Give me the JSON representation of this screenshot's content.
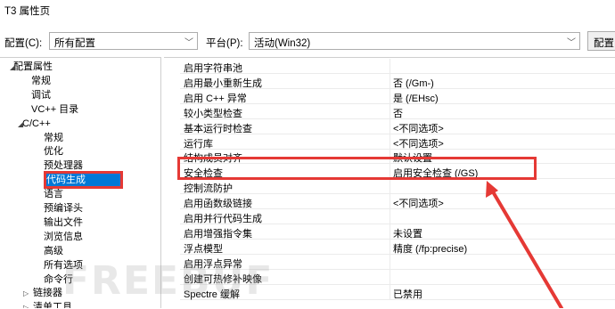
{
  "window": {
    "title": "T3 属性页"
  },
  "config_bar": {
    "config_label": "配置(C):",
    "config_value": "所有配置",
    "platform_label": "平台(P):",
    "platform_value": "活动(Win32)",
    "manager_button": "配置"
  },
  "tree": [
    {
      "label": "配置属性",
      "arrow": "◢"
    },
    {
      "label": "常规"
    },
    {
      "label": "调试"
    },
    {
      "label": "VC++ 目录"
    },
    {
      "label": "C/C++",
      "arrow": "◢"
    },
    {
      "label": "常规"
    },
    {
      "label": "优化"
    },
    {
      "label": "预处理器"
    },
    {
      "label": "代码生成",
      "selected": true
    },
    {
      "label": "语言"
    },
    {
      "label": "预编译头"
    },
    {
      "label": "输出文件"
    },
    {
      "label": "浏览信息"
    },
    {
      "label": "高级"
    },
    {
      "label": "所有选项"
    },
    {
      "label": "命令行"
    },
    {
      "label": "链接器",
      "arrow": "▷"
    },
    {
      "label": "清单工具",
      "arrow": "▷"
    }
  ],
  "properties": [
    {
      "name": "启用字符串池",
      "value": ""
    },
    {
      "name": "启用最小重新生成",
      "value": "否 (/Gm-)"
    },
    {
      "name": "启用 C++ 异常",
      "value": "是 (/EHsc)"
    },
    {
      "name": "较小类型检查",
      "value": "否"
    },
    {
      "name": "基本运行时检查",
      "value": "<不同选项>"
    },
    {
      "name": "运行库",
      "value": "<不同选项>"
    },
    {
      "name": "结构成员对齐",
      "value": "默认设置"
    },
    {
      "name": "安全检查",
      "value": "启用安全检查 (/GS)"
    },
    {
      "name": "控制流防护",
      "value": ""
    },
    {
      "name": "启用函数级链接",
      "value": "<不同选项>"
    },
    {
      "name": "启用并行代码生成",
      "value": ""
    },
    {
      "name": "启用增强指令集",
      "value": "未设置"
    },
    {
      "name": "浮点模型",
      "value": "精度 (/fp:precise)"
    },
    {
      "name": "启用浮点异常",
      "value": ""
    },
    {
      "name": "创建可热修补映像",
      "value": ""
    },
    {
      "name": "Spectre 缓解",
      "value": "已禁用"
    }
  ],
  "watermark": "FREEBUF"
}
